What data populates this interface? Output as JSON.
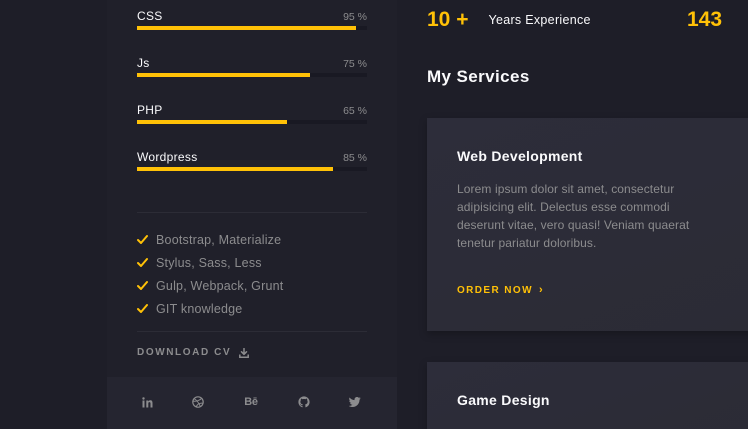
{
  "skills": [
    {
      "name": "CSS",
      "percent_label": "95 %",
      "level": 0.95
    },
    {
      "name": "Js",
      "percent_label": "75 %",
      "level": 0.75
    },
    {
      "name": "PHP",
      "percent_label": "65 %",
      "level": 0.65
    },
    {
      "name": "Wordpress",
      "percent_label": "85 %",
      "level": 0.85
    }
  ],
  "knowledge": [
    "Bootstrap, Materialize",
    "Stylus, Sass, Less",
    "Gulp, Webpack, Grunt",
    "GIT knowledge"
  ],
  "download": {
    "label": "DOWNLOAD CV",
    "icon": "download-icon"
  },
  "social": [
    {
      "name": "linkedin",
      "icon": "linkedin-icon"
    },
    {
      "name": "dribbble",
      "icon": "dribbble-icon"
    },
    {
      "name": "behance",
      "icon": "behance-icon",
      "text": "Bē"
    },
    {
      "name": "github",
      "icon": "github-icon"
    },
    {
      "name": "twitter",
      "icon": "twitter-icon"
    }
  ],
  "counters": [
    {
      "value": "10 +",
      "label": "Years Experience"
    },
    {
      "value": "143",
      "label": ""
    }
  ],
  "services": {
    "title": "My Services",
    "cards": [
      {
        "title": "Web Development",
        "description": "Lorem ipsum dolor sit amet, consectetur adipisicing elit. Delectus esse commodi deserunt vitae, vero quasi! Veniam quaerat tenetur pariatur doloribus.",
        "link_label": "ORDER NOW",
        "link_icon": "chevron-right-icon"
      },
      {
        "title": "Game Design"
      }
    ]
  },
  "colors": {
    "accent": "#ffc107",
    "background": "#1e1e28",
    "panel": "#20202a",
    "card": "#2d2d3a",
    "text_primary": "#fafafc",
    "text_muted": "#8c8c8e"
  }
}
